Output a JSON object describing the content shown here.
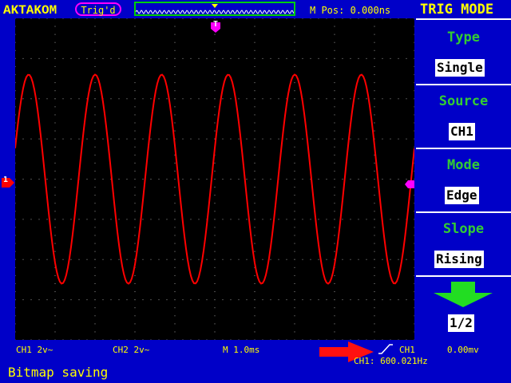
{
  "brand": "AKTAKOM",
  "trigger_status": "Trig'd",
  "m_pos": "M Pos: 0.000ns",
  "menu": {
    "title": "TRIG MODE",
    "items": [
      {
        "label": "Type",
        "value": "Single"
      },
      {
        "label": "Source",
        "value": "CH1"
      },
      {
        "label": "Mode",
        "value": "Edge"
      },
      {
        "label": "Slope",
        "value": "Rising"
      }
    ],
    "page": "1/2"
  },
  "status": {
    "ch1": "CH1 2v~",
    "ch2": "CH2 2v~",
    "timebase": "M 1.0ms",
    "trig_source": "CH1",
    "trig_level": "0.00mv",
    "frequency": "CH1: 600.021Hz"
  },
  "markers": {
    "trigger_pos": "T",
    "ch1": "1"
  },
  "message": "Bitmap saving",
  "colors": {
    "background": "#0000c8",
    "screen": "#000000",
    "trace": "#ff0000",
    "text": "#ffff00",
    "menu_label": "#33cc33",
    "accent": "#ff00ff",
    "arrow": "#ff0000"
  },
  "waveform": {
    "type": "sine",
    "frequency_hz": 600.021,
    "cycles_shown": 6,
    "amplitude_divisions": 2.6
  },
  "icons": {
    "rising_edge": "rising-edge-icon",
    "next_page": "down-arrow-icon",
    "pointer": "red-arrow-icon"
  }
}
